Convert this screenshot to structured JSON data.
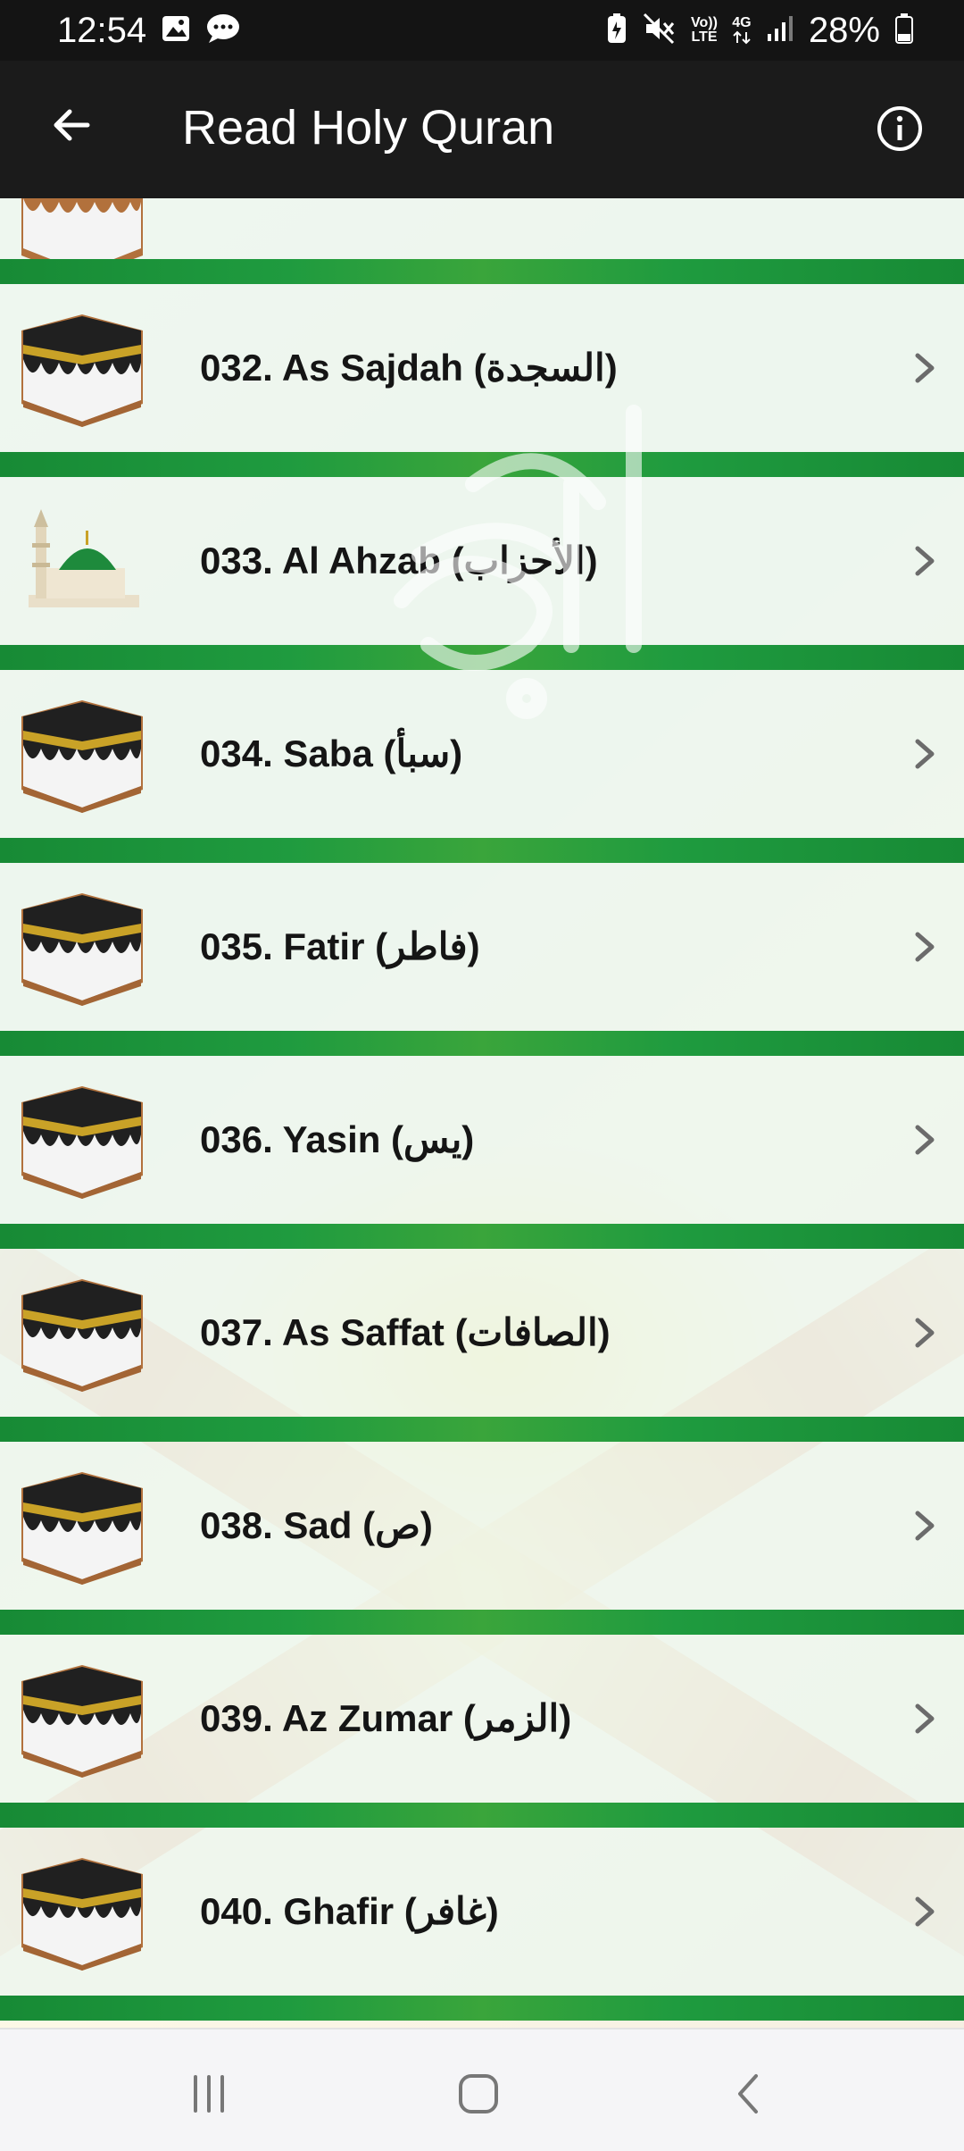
{
  "status_bar": {
    "time": "12:54",
    "battery": "28%",
    "volte_top": "Vo))",
    "volte_bottom": "LTE",
    "network": "4G",
    "icons": [
      "gallery-icon",
      "chat-icon",
      "battery-saver-icon",
      "mute-icon",
      "volte-icon",
      "4g-data-icon",
      "signal-icon",
      "battery-icon"
    ]
  },
  "app_bar": {
    "title": "Read Holy Quran",
    "back_icon": "back-arrow-icon",
    "info_icon": "info-icon"
  },
  "surahs": [
    {
      "label": "032. As Sajdah (السجدة)",
      "thumb": "kaaba"
    },
    {
      "label": "033. Al Ahzab (الأحزاب)",
      "thumb": "mosque-dome"
    },
    {
      "label": "034. Saba (سبأ)",
      "thumb": "kaaba"
    },
    {
      "label": "035. Fatir (فاطر)",
      "thumb": "kaaba"
    },
    {
      "label": "036. Yasin (يس)",
      "thumb": "kaaba"
    },
    {
      "label": "037. As Saffat (الصافات)",
      "thumb": "kaaba"
    },
    {
      "label": "038. Sad (ص)",
      "thumb": "kaaba"
    },
    {
      "label": "039. Az Zumar (الزمر)",
      "thumb": "kaaba"
    },
    {
      "label": "040. Ghafir (غافر)",
      "thumb": "kaaba"
    }
  ],
  "nav_bar": {
    "buttons": [
      "recents-icon",
      "home-icon",
      "back-icon"
    ]
  },
  "colors": {
    "status_bar_bg": "#141414",
    "app_bar_bg": "#1b1b1b",
    "row_separator": "#1f9b3f",
    "row_bg": "#ecf6ee"
  }
}
